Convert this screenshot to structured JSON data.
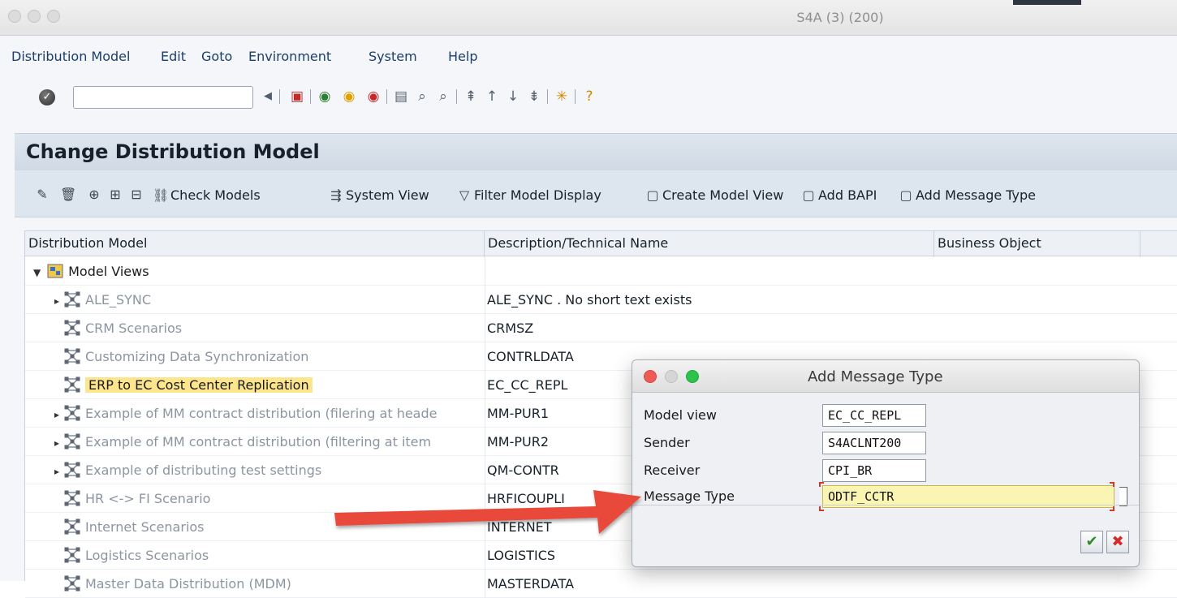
{
  "window": {
    "title": "S4A (3) (200)"
  },
  "menu": [
    "Distribution Model",
    "Edit",
    "Goto",
    "Environment",
    "System",
    "Help"
  ],
  "toolbar": {
    "command_value": ""
  },
  "screen": {
    "title": "Change Distribution Model",
    "buttons": {
      "check_models": "Check Models",
      "system_view": "System View",
      "filter_model_display": "Filter Model Display",
      "create_model_view": "Create Model View",
      "add_bapi": "Add BAPI",
      "add_message_type": "Add Message Type"
    }
  },
  "table": {
    "headers": [
      "Distribution Model",
      "Description/Technical Name",
      "Business Object"
    ],
    "root": "Model Views",
    "rows": [
      {
        "name": "ALE_SYNC",
        "desc": "ALE_SYNC  . No short text exists"
      },
      {
        "name": "CRM Scenarios",
        "desc": "CRMSZ"
      },
      {
        "name": "Customizing Data Synchronization",
        "desc": "CONTRLDATA"
      },
      {
        "name": "ERP to EC Cost Center Replication",
        "desc": "EC_CC_REPL"
      },
      {
        "name": "Example of MM contract distribution (filering at heade",
        "desc": "MM-PUR1"
      },
      {
        "name": "Example of MM contract distribution (filtering at item",
        "desc": "MM-PUR2"
      },
      {
        "name": "Example of distributing test settings",
        "desc": "QM-CONTR"
      },
      {
        "name": "HR <-> FI Scenario",
        "desc": "HRFICOUPLI"
      },
      {
        "name": "Internet Scenarios",
        "desc": "INTERNET"
      },
      {
        "name": "Logistics Scenarios",
        "desc": "LOGISTICS"
      },
      {
        "name": "Master Data Distribution (MDM)",
        "desc": "MASTERDATA"
      }
    ]
  },
  "dialog": {
    "title": "Add Message Type",
    "fields": [
      {
        "label": "Model view",
        "value": "EC_CC_REPL"
      },
      {
        "label": "Sender",
        "value": "S4ACLNT200"
      },
      {
        "label": "Receiver",
        "value": "CPI_BR"
      },
      {
        "label": "Message Type",
        "value": "ODTF_CCTR"
      }
    ],
    "ok_symbol": "✔",
    "cancel_symbol": "✖"
  },
  "colors": {
    "highlight": "#fde58d",
    "arrow": "#e8483b",
    "dialog_close": "#ee5b54",
    "dialog_zoom": "#2dc34a"
  }
}
